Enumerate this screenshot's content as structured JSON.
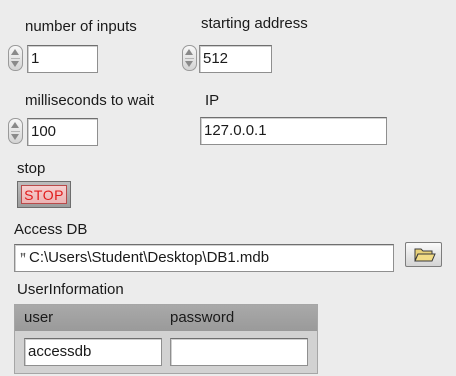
{
  "controls": {
    "number_of_inputs": {
      "label": "number of inputs",
      "value": "1"
    },
    "starting_address": {
      "label": "starting address",
      "value": "512"
    },
    "milliseconds_to_wait": {
      "label": "milliseconds to wait",
      "value": "100"
    },
    "ip": {
      "label": "IP",
      "value": "127.0.0.1"
    }
  },
  "stop": {
    "label": "stop",
    "button_text": "STOP",
    "color": "#e11b1b"
  },
  "access_db": {
    "label": "Access DB",
    "path": "C:\\Users\\Student\\Desktop\\DB1.mdb",
    "path_icon": "path-icon",
    "browse_icon": "folder-open-icon"
  },
  "user_information": {
    "label": "UserInformation",
    "user_label": "user",
    "user_value": "accessdb",
    "password_label": "password",
    "password_value": ""
  }
}
